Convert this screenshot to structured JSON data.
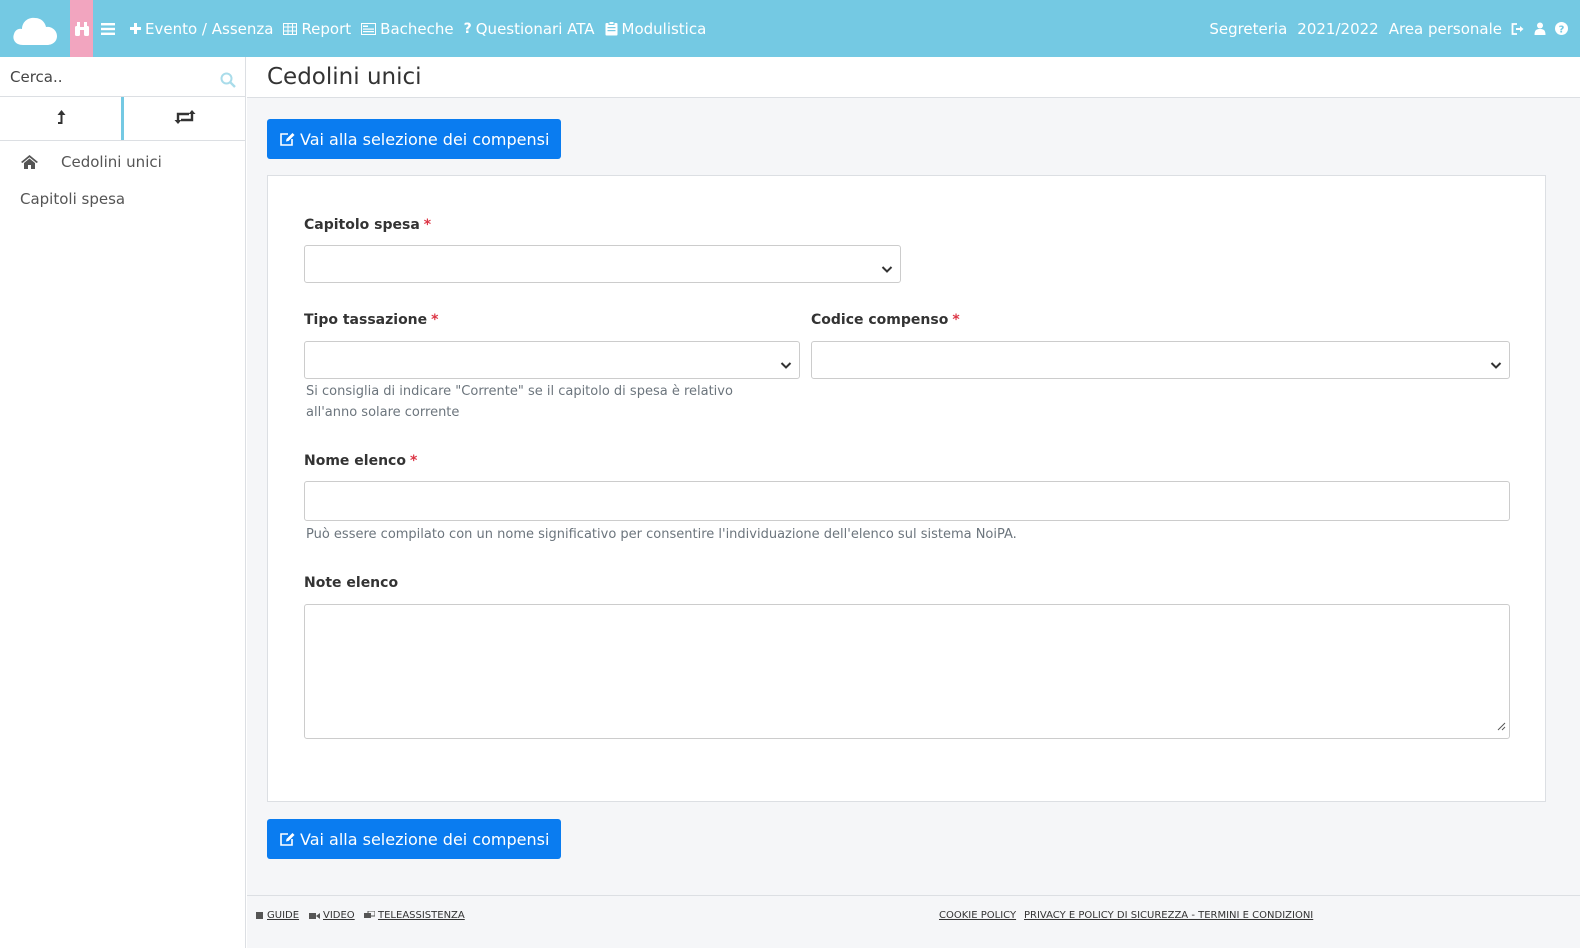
{
  "topbar": {
    "nav": [
      {
        "label": "Evento / Assenza",
        "icon": "plus-icon"
      },
      {
        "label": "Report",
        "icon": "table-icon"
      },
      {
        "label": "Bacheche",
        "icon": "board-icon"
      },
      {
        "label": "Questionari ATA",
        "icon": "question-icon"
      },
      {
        "label": "Modulistica",
        "icon": "clipboard-icon"
      }
    ],
    "right": {
      "area": "Segreteria",
      "year": "2021/2022",
      "personal": "Area personale"
    }
  },
  "sidebar": {
    "search_placeholder": "Cerca..",
    "items": [
      {
        "label": "Cedolini unici",
        "icon": "home-icon"
      },
      {
        "label": "Capitoli spesa"
      }
    ]
  },
  "main": {
    "title": "Cedolini unici",
    "action_button": "Vai alla selezione dei compensi",
    "form": {
      "capitolo_spesa": {
        "label": "Capitolo spesa",
        "required": "*",
        "value": ""
      },
      "tipo_tassazione": {
        "label": "Tipo tassazione",
        "required": "*",
        "value": "",
        "hint": "Si consiglia di indicare \"Corrente\" se il capitolo di spesa è relativo all'anno solare corrente"
      },
      "codice_compenso": {
        "label": "Codice compenso",
        "required": "*",
        "value": ""
      },
      "nome_elenco": {
        "label": "Nome elenco",
        "required": "*",
        "value": "",
        "hint": "Può essere compilato con un nome significativo per consentire l'individuazione dell'elenco sul sistema NoiPA."
      },
      "note_elenco": {
        "label": "Note elenco",
        "value": ""
      }
    }
  },
  "footer": {
    "guide": "GUIDE",
    "video": "VIDEO",
    "teleassistenza": "TELEASSISTENZA",
    "cookie": "COOKIE POLICY",
    "privacy": "PRIVACY E POLICY DI SICUREZZA - TERMINI E CONDIZIONI"
  },
  "colors": {
    "topbar": "#74c9e3",
    "binoculars_bg": "#f2a5bf",
    "primary_button": "#0a7cf0",
    "required_star": "#dc3545"
  }
}
